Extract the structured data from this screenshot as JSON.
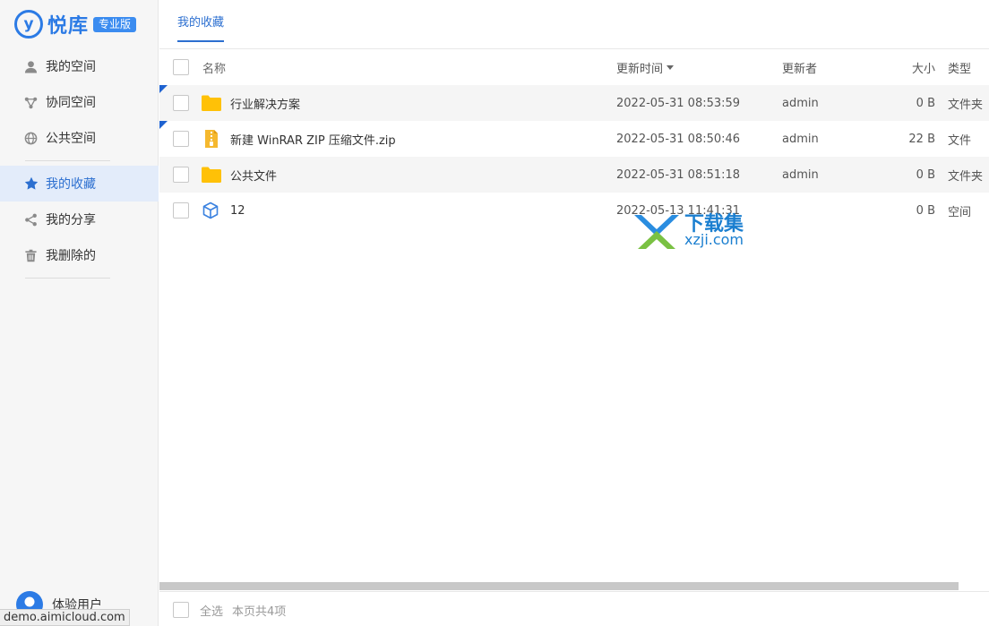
{
  "brand": {
    "logo_letter": "y",
    "name": "悦库",
    "edition": "专业版",
    "accent": "#2c7be5"
  },
  "sidebar": {
    "items": [
      {
        "label": "我的空间",
        "icon": "person-icon"
      },
      {
        "label": "协同空间",
        "icon": "share-nodes-icon"
      },
      {
        "label": "公共空间",
        "icon": "globe-icon"
      },
      {
        "label": "我的收藏",
        "icon": "star-icon",
        "active": true
      },
      {
        "label": "我的分享",
        "icon": "share-icon"
      },
      {
        "label": "我删除的",
        "icon": "trash-icon"
      }
    ]
  },
  "user": {
    "name": "体验用户"
  },
  "url_tip": "demo.aimicloud.com",
  "tab": {
    "label": "我的收藏"
  },
  "table": {
    "headers": {
      "name": "名称",
      "time": "更新时间",
      "updater": "更新者",
      "size": "大小",
      "type": "类型"
    },
    "rows": [
      {
        "name": "行业解决方案",
        "time": "2022-05-31 08:53:59",
        "updater": "admin",
        "size": "0 B",
        "type": "文件夹",
        "icon": "folder-icon",
        "flag": true
      },
      {
        "name": "新建 WinRAR ZIP 压缩文件.zip",
        "time": "2022-05-31 08:50:46",
        "updater": "admin",
        "size": "22 B",
        "type": "文件",
        "icon": "zip-file-icon",
        "flag": true
      },
      {
        "name": "公共文件",
        "time": "2022-05-31 08:51:18",
        "updater": "admin",
        "size": "0 B",
        "type": "文件夹",
        "icon": "folder-icon",
        "flag": false
      },
      {
        "name": "12",
        "time": "2022-05-13 11:41:31",
        "updater": "",
        "size": "0 B",
        "type": "空间",
        "icon": "cube-icon",
        "flag": false
      }
    ]
  },
  "watermark": {
    "line1": "下载集",
    "line2": "xzji.com"
  },
  "footer": {
    "select_all": "全选",
    "count": "本页共4项"
  }
}
